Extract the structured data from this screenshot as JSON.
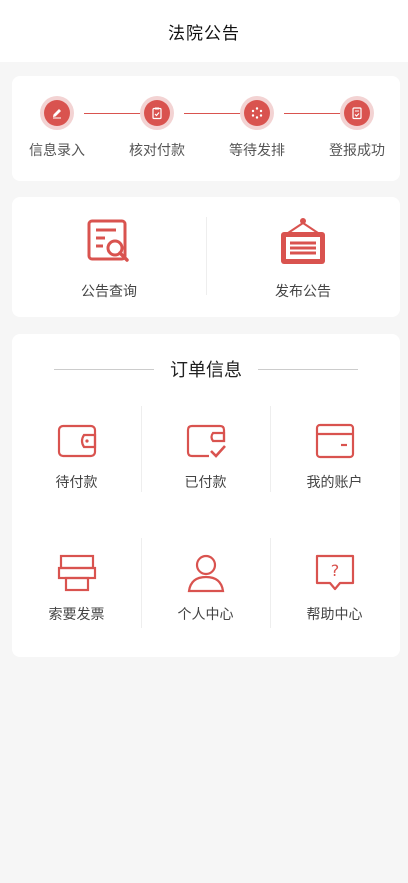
{
  "header": {
    "title": "法院公告"
  },
  "steps": [
    {
      "label": "信息录入",
      "icon": "pencil-icon"
    },
    {
      "label": "核对付款",
      "icon": "clipboard-check-icon"
    },
    {
      "label": "等待发排",
      "icon": "loading-icon"
    },
    {
      "label": "登报成功",
      "icon": "document-check-icon"
    }
  ],
  "quick_actions": [
    {
      "label": "公告查询",
      "icon": "document-search-icon"
    },
    {
      "label": "发布公告",
      "icon": "notice-board-icon"
    }
  ],
  "orders": {
    "title": "订单信息",
    "items": [
      {
        "label": "待付款",
        "icon": "wallet-icon"
      },
      {
        "label": "已付款",
        "icon": "wallet-check-icon"
      },
      {
        "label": "我的账户",
        "icon": "card-icon"
      },
      {
        "label": "索要发票",
        "icon": "printer-icon"
      },
      {
        "label": "个人中心",
        "icon": "user-icon"
      },
      {
        "label": "帮助中心",
        "icon": "help-icon"
      }
    ]
  },
  "colors": {
    "accent": "#d9534f",
    "accent_light": "#f3d3d3",
    "background": "#f6f6f6"
  }
}
